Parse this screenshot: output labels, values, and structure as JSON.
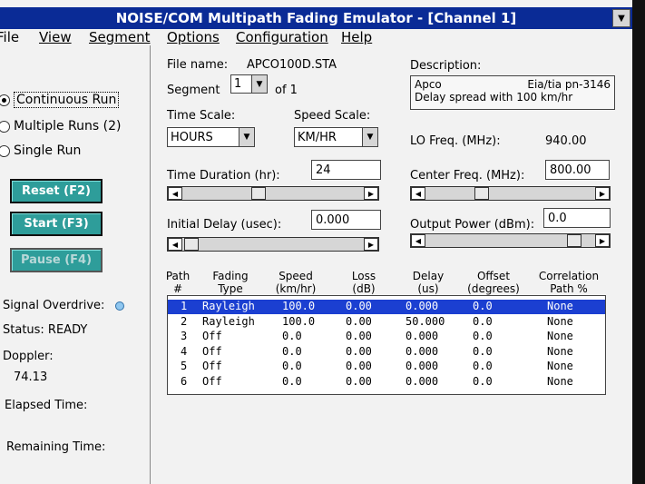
{
  "window": {
    "title": "NOISE/COM Multipath Fading Emulator - [Channel 1]",
    "title_btn": "▼"
  },
  "menu": [
    "File",
    "View",
    "Segment",
    "Options",
    "Configuration",
    "Help"
  ],
  "run_modes": [
    {
      "label": "Continuous Run",
      "selected": true
    },
    {
      "label": "Multiple Runs (2)",
      "selected": false
    },
    {
      "label": "Single Run",
      "selected": false
    }
  ],
  "buttons": {
    "reset": "Reset (F2)",
    "start": "Start (F3)",
    "pause": "Pause (F4)"
  },
  "status": {
    "signal_overdrive_label": "Signal Overdrive:",
    "status_text": "Status: READY",
    "doppler_label": "Doppler:",
    "doppler_value": "74.13",
    "elapsed_label": "Elapsed Time:",
    "remaining_label": "Remaining Time:"
  },
  "file": {
    "label": "File name:",
    "value": "APCO100D.STA"
  },
  "segment": {
    "label": "Segment",
    "value": "1",
    "of_text": "of 1"
  },
  "description": {
    "label": "Description:",
    "line1_left": "Apco",
    "line1_right": "Eia/tia pn-3146",
    "line2": "Delay spread with 100 km/hr"
  },
  "time_scale": {
    "label": "Time Scale:",
    "value": "HOURS"
  },
  "speed_scale": {
    "label": "Speed Scale:",
    "value": "KM/HR"
  },
  "lo_freq": {
    "label": "LO Freq. (MHz):",
    "value": "940.00"
  },
  "time_duration": {
    "label": "Time Duration  (hr):",
    "value": "24"
  },
  "center_freq": {
    "label": "Center Freq. (MHz):",
    "value": "800.00"
  },
  "initial_delay": {
    "label": "Initial Delay (usec):",
    "value": "0.000"
  },
  "output_power": {
    "label": "Output Power (dBm):",
    "value": "0.0"
  },
  "arrows": {
    "left": "◀",
    "right": "▶",
    "down": "▼"
  },
  "table": {
    "headers": [
      [
        "Path",
        "#"
      ],
      [
        "Fading",
        "Type"
      ],
      [
        "Speed",
        "(km/hr)"
      ],
      [
        "Loss",
        "(dB)"
      ],
      [
        "Delay",
        "(us)"
      ],
      [
        "Offset",
        "(degrees)"
      ],
      [
        "Correlation",
        "Path  %"
      ]
    ],
    "rows": [
      [
        "1",
        "Rayleigh",
        "100.0",
        "0.00",
        "0.000",
        "0.0",
        "None"
      ],
      [
        "2",
        "Rayleigh",
        "100.0",
        "0.00",
        "50.000",
        "0.0",
        "None"
      ],
      [
        "3",
        "Off",
        "0.0",
        "0.00",
        "0.000",
        "0.0",
        "None"
      ],
      [
        "4",
        "Off",
        "0.0",
        "0.00",
        "0.000",
        "0.0",
        "None"
      ],
      [
        "5",
        "Off",
        "0.0",
        "0.00",
        "0.000",
        "0.0",
        "None"
      ],
      [
        "6",
        "Off",
        "0.0",
        "0.00",
        "0.000",
        "0.0",
        "None"
      ]
    ],
    "selected_row": 0
  }
}
